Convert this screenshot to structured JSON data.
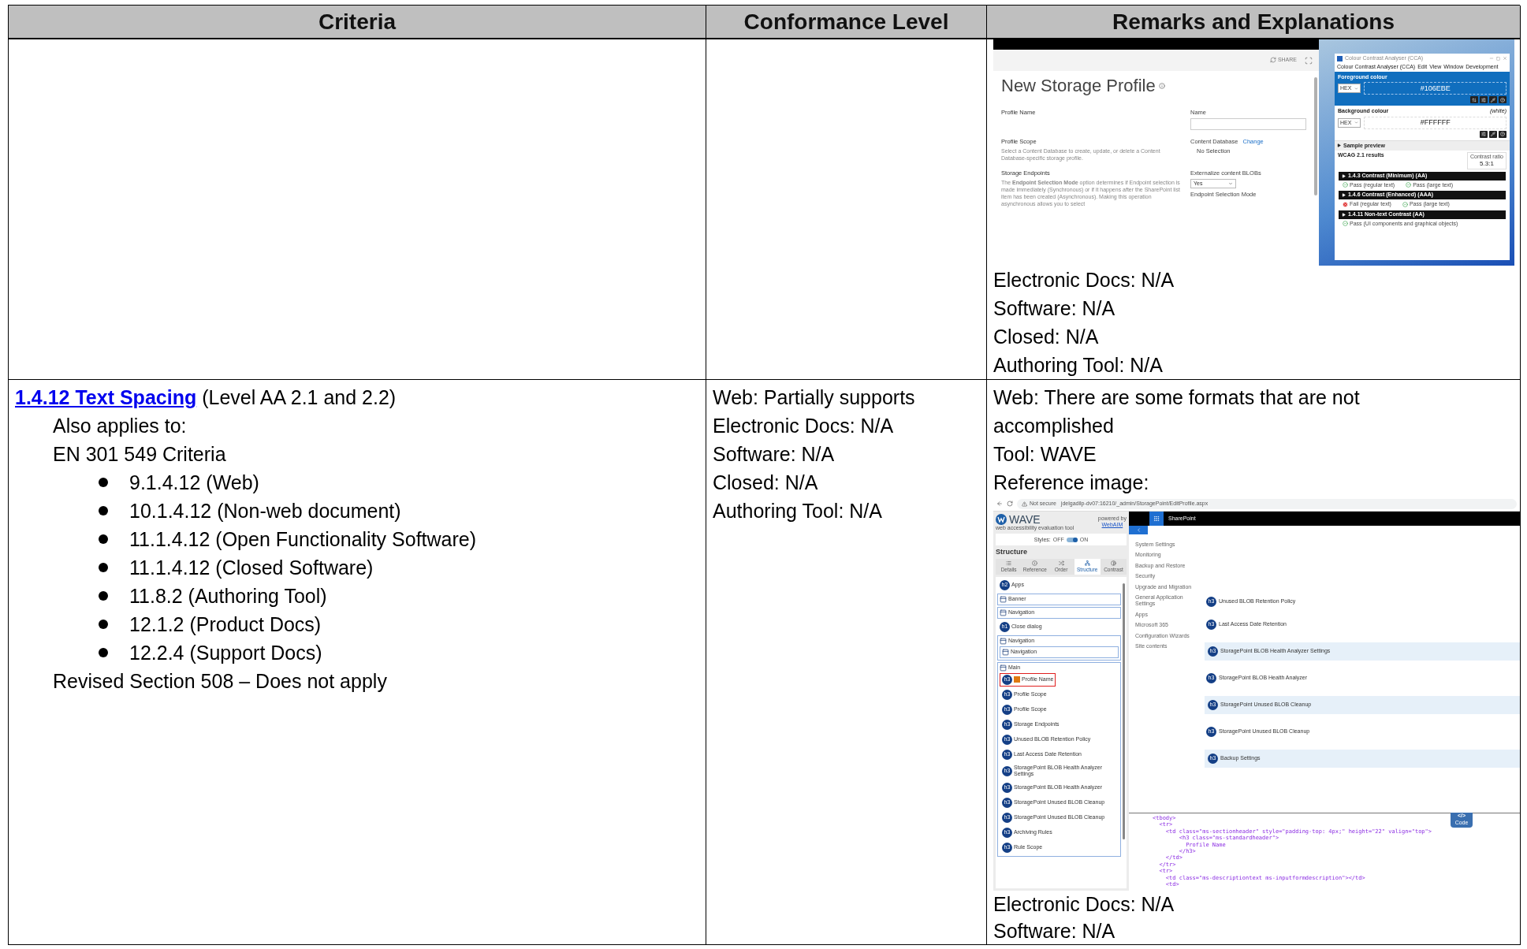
{
  "table": {
    "columns": [
      "Criteria",
      "Conformance Level",
      "Remarks and Explanations"
    ],
    "rows": [
      {
        "remarks": {
          "screenshot": {
            "kind": "storage_profile",
            "share": "SHARE",
            "title": "New Storage Profile",
            "sections": [
              {
                "heading": "Profile Name"
              },
              {
                "heading": "Profile Scope",
                "text": "Select a Content Database to create, update, or delete a Content Database-specific storage profile."
              },
              {
                "heading": "Storage Endpoints",
                "text": "The **Endpoint Selection Mode** option determines if Endpoint selection is made immediately (Synchronous) or if it happens after the SharePoint list item has been created (Asynchronous). Making this operation asynchronous allows you to select"
              }
            ],
            "name_label": "Name",
            "db_label": "Content Database",
            "db_change": "Change",
            "db_value": "No Selection",
            "blob_label": "Externalize content BLOBs",
            "blob_value": "Yes",
            "mode_label": "Endpoint Selection Mode",
            "cca": {
              "title": "Colour Contrast Analyser (CCA)",
              "menu": [
                "Colour Contrast Analyser (CCA)",
                "Edit",
                "View",
                "Window",
                "Development"
              ],
              "fg_label": "Foreground colour",
              "fg_format": "HEX",
              "fg_value": "#106EBE",
              "bg_label": "Background colour",
              "bg_note": "(white)",
              "bg_format": "HEX",
              "bg_value": "#FFFFFF",
              "sample": "Sample preview",
              "results_title": "WCAG 2.1 results",
              "ratio_label": "Contrast ratio",
              "ratio": "5.3:1",
              "criteria": [
                {
                  "title": "1.4.3 Contrast (Minimum) (AA)",
                  "results": [
                    {
                      "text": "Pass (regular text)",
                      "pass": true
                    },
                    {
                      "text": "Pass (large text)",
                      "pass": true
                    }
                  ]
                },
                {
                  "title": "1.4.6 Contrast (Enhanced) (AAA)",
                  "results": [
                    {
                      "text": "Fail (regular text)",
                      "pass": false
                    },
                    {
                      "text": "Pass (large text)",
                      "pass": true
                    }
                  ]
                },
                {
                  "title": "1.4.11 Non-text Contrast (AA)",
                  "results": [
                    {
                      "text": "Pass (UI components and graphical objects)",
                      "pass": true
                    }
                  ]
                }
              ]
            }
          },
          "after": [
            "Electronic Docs: N/A",
            "Software: N/A",
            "Closed: N/A",
            "Authoring Tool: N/A"
          ]
        }
      },
      {
        "criteria": {
          "link": "1.4.12 Text Spacing",
          "title_rest": " (Level AA 2.1 and 2.2)",
          "also": "Also applies to:",
          "standard": "EN 301 549 Criteria",
          "bullets": [
            "9.1.4.12 (Web)",
            "10.1.4.12 (Non-web document)",
            "11.1.4.12 (Open Functionality Software)",
            "11.1.4.12 (Closed Software)",
            "11.8.2 (Authoring Tool)",
            "12.1.2 (Product Docs)",
            "12.2.4 (Support Docs)"
          ],
          "note": "Revised Section 508 – Does not apply"
        },
        "conformance": [
          "Web: Partially supports",
          "Electronic Docs: N/A",
          "Software: N/A",
          "Closed: N/A",
          "Authoring Tool: N/A"
        ],
        "remarks": {
          "before": [
            "Web: There are some formats that are not accomplished",
            "Tool: WAVE",
            "Reference image:"
          ],
          "screenshot": {
            "kind": "wave",
            "security": "Not secure",
            "url": "jdelgadilp-dv07:16210/_admin/StoragePoint/EditProfile.aspx",
            "logo": "WAVE",
            "tagline": "web accessibility evaluation tool",
            "powered": "powered by",
            "powered_link": "WebAIM",
            "styles_label": "Styles:",
            "styles_off": "OFF",
            "styles_on_label": "ON",
            "styles_on": true,
            "panel_title": "Structure",
            "tabs": [
              {
                "label": "Details",
                "selected": false
              },
              {
                "label": "Reference",
                "selected": false
              },
              {
                "label": "Order",
                "selected": false
              },
              {
                "label": "Structure",
                "selected": true
              },
              {
                "label": "Contrast",
                "selected": false
              }
            ],
            "tree": [
              {
                "kind": "heading",
                "badge": "h2",
                "label": "Apps"
              },
              {
                "kind": "landmark",
                "label": "Banner"
              },
              {
                "kind": "landmark",
                "label": "Navigation"
              },
              {
                "kind": "heading",
                "badge": "h1",
                "label": "Close dialog"
              },
              {
                "kind": "landmark",
                "label": "Navigation",
                "children": [
                  {
                    "kind": "landmark",
                    "label": "Navigation"
                  }
                ]
              },
              {
                "kind": "landmark",
                "label": "Main",
                "children": [
                  {
                    "kind": "heading",
                    "badge": "h3",
                    "label": "Profile Name",
                    "highlighted": true
                  },
                  {
                    "kind": "heading",
                    "badge": "h3",
                    "label": "Profile Scope",
                    "highlighted": false
                  },
                  {
                    "kind": "heading",
                    "badge": "h3",
                    "label": "Profile Scope",
                    "highlighted": false
                  },
                  {
                    "kind": "heading",
                    "badge": "h3",
                    "label": "Storage Endpoints",
                    "highlighted": false
                  },
                  {
                    "kind": "heading",
                    "badge": "h3",
                    "label": "Unused BLOB Retention Policy",
                    "highlighted": false
                  },
                  {
                    "kind": "heading",
                    "badge": "h3",
                    "label": "Last Access Date Retention",
                    "highlighted": false
                  },
                  {
                    "kind": "heading",
                    "badge": "h3",
                    "label": "StoragePoint BLOB Health Analyzer Settings",
                    "highlighted": false
                  },
                  {
                    "kind": "heading",
                    "badge": "h3",
                    "label": "StoragePoint BLOB Health Analyzer",
                    "highlighted": false
                  },
                  {
                    "kind": "heading",
                    "badge": "h3",
                    "label": "StoragePoint Unused BLOB Cleanup",
                    "highlighted": false
                  },
                  {
                    "kind": "heading",
                    "badge": "h3",
                    "label": "StoragePoint Unused BLOB Cleanup",
                    "highlighted": false
                  },
                  {
                    "kind": "heading",
                    "badge": "h3",
                    "label": "Archiving Rules",
                    "highlighted": false
                  },
                  {
                    "kind": "heading",
                    "badge": "h3",
                    "label": "Rule Scope",
                    "highlighted": false
                  }
                ]
              }
            ],
            "site": "SharePoint",
            "nav": [
              "System Settings",
              "Monitoring",
              "Backup and Restore",
              "Security",
              "Upgrade and Migration",
              "General Application Settings",
              "Apps",
              "Microsoft 365",
              "Configuration Wizards",
              "Site contents"
            ],
            "headings": [
              {
                "badge": "h3",
                "label": "Unused BLOB Retention Policy",
                "band": false
              },
              {
                "badge": "h3",
                "label": "Last Access Date Retention",
                "band": false
              },
              {
                "badge": "h3",
                "label": "StoragePoint BLOB Health Analyzer Settings",
                "band": true
              },
              {
                "badge": "h3",
                "label": "StoragePoint BLOB Health Analyzer",
                "band": false
              },
              {
                "badge": "h3",
                "label": "StoragePoint Unused BLOB Cleanup",
                "band": true
              },
              {
                "badge": "h3",
                "label": "StoragePoint Unused BLOB Cleanup",
                "band": false
              },
              {
                "badge": "h3",
                "label": "Backup Settings",
                "band": true
              }
            ],
            "code_glyph": "</>",
            "code_label": "Code",
            "code": [
              "<tbody>",
              "  <tr>",
              "    <td class=\"ms-sectionheader\" style=\"padding-top: 4px;\" height=\"22\" valign=\"top\">",
              "        <h3 class=\"ms-standardheader\">",
              "          Profile Name",
              "        </h3>",
              "    </td>",
              "  </tr>",
              "  <tr>",
              "    <td class=\"ms-descriptiontext ms-inputformdescription\"></td>",
              "    <td>"
            ]
          },
          "after": [
            "Electronic Docs: N/A",
            "Software: N/A"
          ]
        }
      }
    ]
  }
}
